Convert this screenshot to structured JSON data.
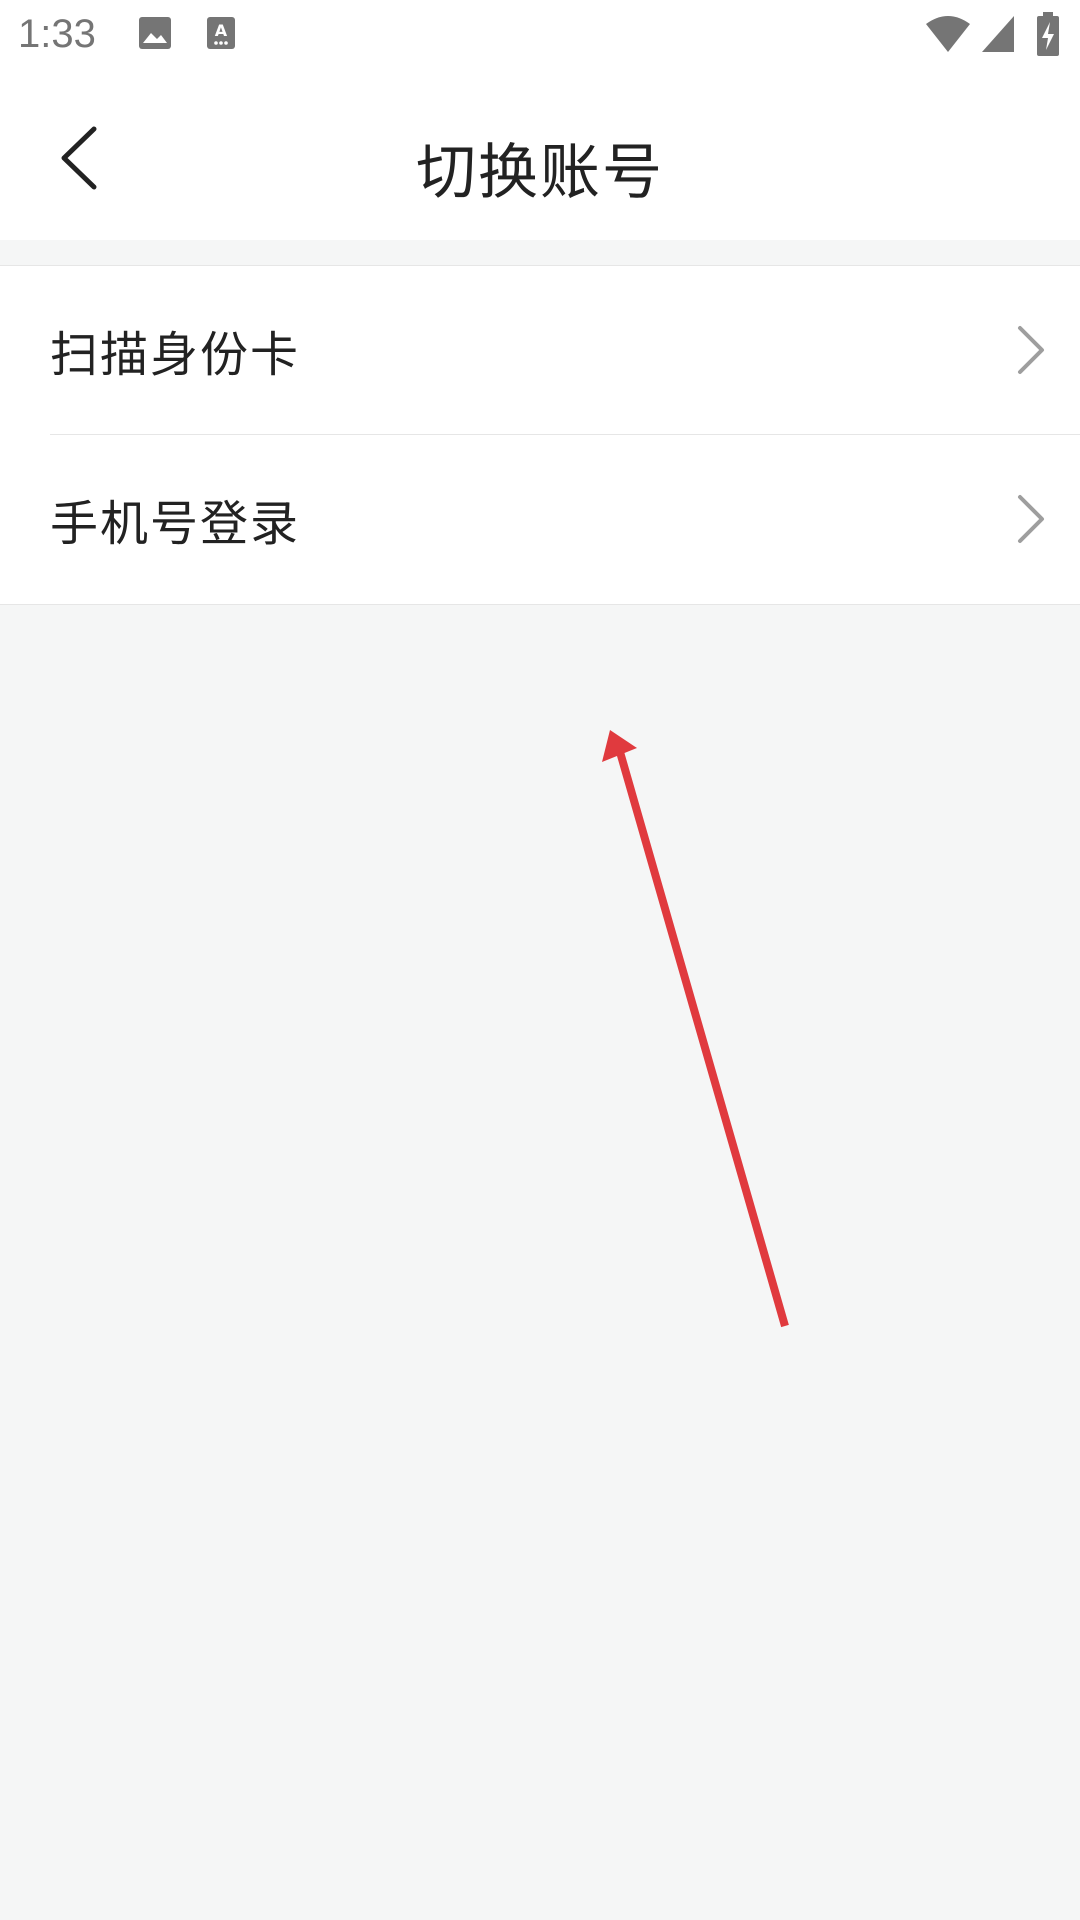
{
  "status_bar": {
    "time": "1:33",
    "icons": [
      "image-icon",
      "keyboard-a-icon",
      "wifi-icon",
      "signal-icon",
      "battery-charging-icon"
    ]
  },
  "header": {
    "title": "切换账号",
    "back_icon": "chevron-left-icon"
  },
  "menu": {
    "items": [
      {
        "label": "扫描身份卡",
        "icon": "chevron-right-icon"
      },
      {
        "label": "手机号登录",
        "icon": "chevron-right-icon"
      }
    ]
  },
  "annotation": {
    "color": "#e03a3e",
    "type": "arrow"
  },
  "colors": {
    "background": "#f5f6f6",
    "surface": "#ffffff",
    "text": "#222222",
    "divider": "#e6e6e6"
  }
}
